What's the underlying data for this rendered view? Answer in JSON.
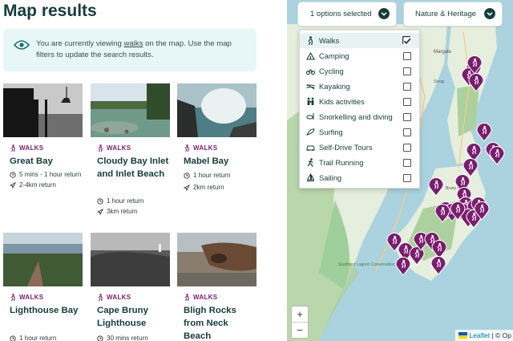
{
  "page": {
    "title": "Map results"
  },
  "notice": {
    "before": "You are currently viewing ",
    "link": "walks",
    "after": " on the map. Use the map filters to update the search results."
  },
  "cards": [
    {
      "badge": "WALKS",
      "title": "Great Bay",
      "meta": [
        "5 mins - 1 hour return",
        "2-4km return"
      ]
    },
    {
      "badge": "WALKS",
      "title": "Cloudy Bay Inlet and Inlet Beach",
      "meta": [
        "1 hour return",
        "3km return"
      ]
    },
    {
      "badge": "WALKS",
      "title": "Mabel Bay",
      "meta": [
        "1 hour return",
        "2km return"
      ]
    },
    {
      "badge": "WALKS",
      "title": "Lighthouse Bay",
      "meta": [
        "1 hour return"
      ]
    },
    {
      "badge": "WALKS",
      "title": "Cape Bruny Lighthouse",
      "meta": [
        "30 mins return"
      ]
    },
    {
      "badge": "WALKS",
      "title": "Bligh Rocks from Neck Beach",
      "meta": []
    }
  ],
  "filters": {
    "options_label": "1 options selected",
    "category_label": "Nature & Heritage"
  },
  "dropdown": [
    {
      "label": "Walks",
      "checked": true,
      "icon": "hiker-icon"
    },
    {
      "label": "Camping",
      "checked": false,
      "icon": "tent-icon"
    },
    {
      "label": "Cycling",
      "checked": false,
      "icon": "bicycle-icon"
    },
    {
      "label": "Kayaking",
      "checked": false,
      "icon": "kayak-icon"
    },
    {
      "label": "Kids activities",
      "checked": false,
      "icon": "family-icon"
    },
    {
      "label": "Snorkelling and diving",
      "checked": false,
      "icon": "snorkel-icon"
    },
    {
      "label": "Surfing",
      "checked": false,
      "icon": "surfboard-icon"
    },
    {
      "label": "Self-Drive Tours",
      "checked": false,
      "icon": "car-icon"
    },
    {
      "label": "Trail Running",
      "checked": false,
      "icon": "runner-icon"
    },
    {
      "label": "Sailing",
      "checked": false,
      "icon": "sailboat-icon"
    }
  ],
  "map": {
    "place_labels": [
      "Margate",
      "Snug",
      "Bruny Island",
      "Southport Lagoon Conservation Area"
    ],
    "zoom_in": "+",
    "zoom_out": "−",
    "attribution_leaflet": "Leaflet",
    "attribution_sep": " | © Op",
    "flag_icon": "ukraine-flag-icon"
  },
  "colors": {
    "accent": "#7a1d6e",
    "heading": "#163d3a",
    "notice_bg": "#e7f6f6",
    "water": "#aad3df",
    "land": "#e6eedd",
    "forest": "#add19e"
  }
}
